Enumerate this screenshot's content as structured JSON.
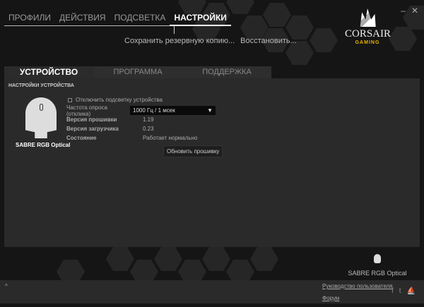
{
  "nav": {
    "items": [
      "ПРОФИЛИ",
      "ДЕЙСТВИЯ",
      "ПОДСВЕТКА",
      "НАСТРОЙКИ"
    ]
  },
  "actions": {
    "backup": "Сохранить резервную копию...",
    "restore": "Восстановить..."
  },
  "logo": {
    "brand": "CORSAIR",
    "sub": "GAMING"
  },
  "window": {
    "minimize": "–",
    "close": "✕"
  },
  "tabs": [
    "УСТРОЙСТВО",
    "ПРОГРАММА",
    "ПОДДЕРЖКА"
  ],
  "section_title": "НАСТРОЙКИ УСТРОЙСТВА",
  "device": {
    "name": "SABRE RGB Optical"
  },
  "settings": {
    "disable_lighting": "Отключить подсветку устройства",
    "polling_label": "Частота опроса (отклика)",
    "polling_value": "1000 Гц / 1 мсек",
    "firmware_label": "Версия прошивки",
    "firmware_value": "1.19",
    "bootloader_label": "Версия загрузчика",
    "bootloader_value": "0.23",
    "status_label": "Состояние",
    "status_value": "Работает нормально",
    "update_button": "Обновить прошивку"
  },
  "footer": {
    "expand": "^",
    "manual": "Руководство пользователя",
    "forum": "Форум",
    "facebook": "f",
    "twitter": "t",
    "corsair": "⛵"
  }
}
